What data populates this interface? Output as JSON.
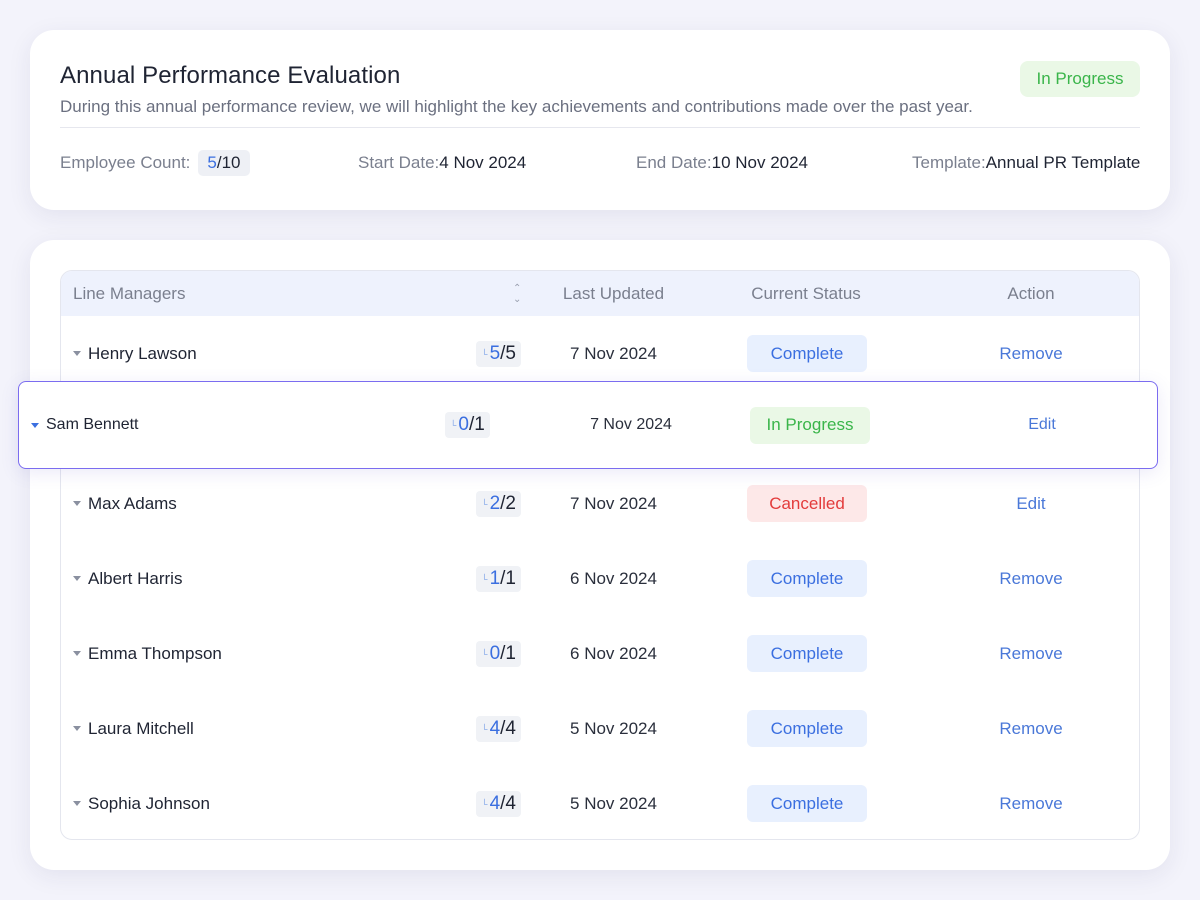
{
  "evaluation": {
    "title": "Annual Performance Evaluation",
    "description": "During this annual performance review, we will highlight the key achievements and contributions made over the past year.",
    "status": "In Progress",
    "employee_count_label": "Employee Count:",
    "employee_count_done": "5",
    "employee_count_total": "/10",
    "start_date_label": "Start Date:",
    "start_date": "4 Nov 2024",
    "end_date_label": "End Date:",
    "end_date": "10 Nov 2024",
    "template_label": "Template:",
    "template": "Annual PR Template"
  },
  "table": {
    "columns": {
      "name": "Line Managers",
      "sort_icon": "sort-icon",
      "updated": "Last Updated",
      "status": "Current Status",
      "action": "Action"
    },
    "rows": [
      {
        "name": "Henry Lawson",
        "done": "5",
        "total": "/5",
        "updated": "7 Nov 2024",
        "status": "Complete",
        "action": "Remove"
      },
      {
        "name": "Sam Bennett",
        "done": "0",
        "total": "/1",
        "updated": "7 Nov 2024",
        "status": "In Progress",
        "action": "Edit"
      },
      {
        "name": "Max Adams",
        "done": "2",
        "total": "/2",
        "updated": "7 Nov 2024",
        "status": "Cancelled",
        "action": "Edit"
      },
      {
        "name": "Albert Harris",
        "done": "1",
        "total": "/1",
        "updated": "6 Nov 2024",
        "status": "Complete",
        "action": "Remove"
      },
      {
        "name": "Emma Thompson",
        "done": "0",
        "total": "/1",
        "updated": "6 Nov 2024",
        "status": "Complete",
        "action": "Remove"
      },
      {
        "name": "Laura Mitchell",
        "done": "4",
        "total": "/4",
        "updated": "5 Nov 2024",
        "status": "Complete",
        "action": "Remove"
      },
      {
        "name": "Sophia Johnson",
        "done": "4",
        "total": "/4",
        "updated": "5 Nov 2024",
        "status": "Complete",
        "action": "Remove"
      }
    ]
  },
  "colors": {
    "accent_blue": "#3b6fe0",
    "success_green": "#3ab54a",
    "danger_red": "#e33b3b",
    "highlight_border": "#7b6cf0"
  }
}
